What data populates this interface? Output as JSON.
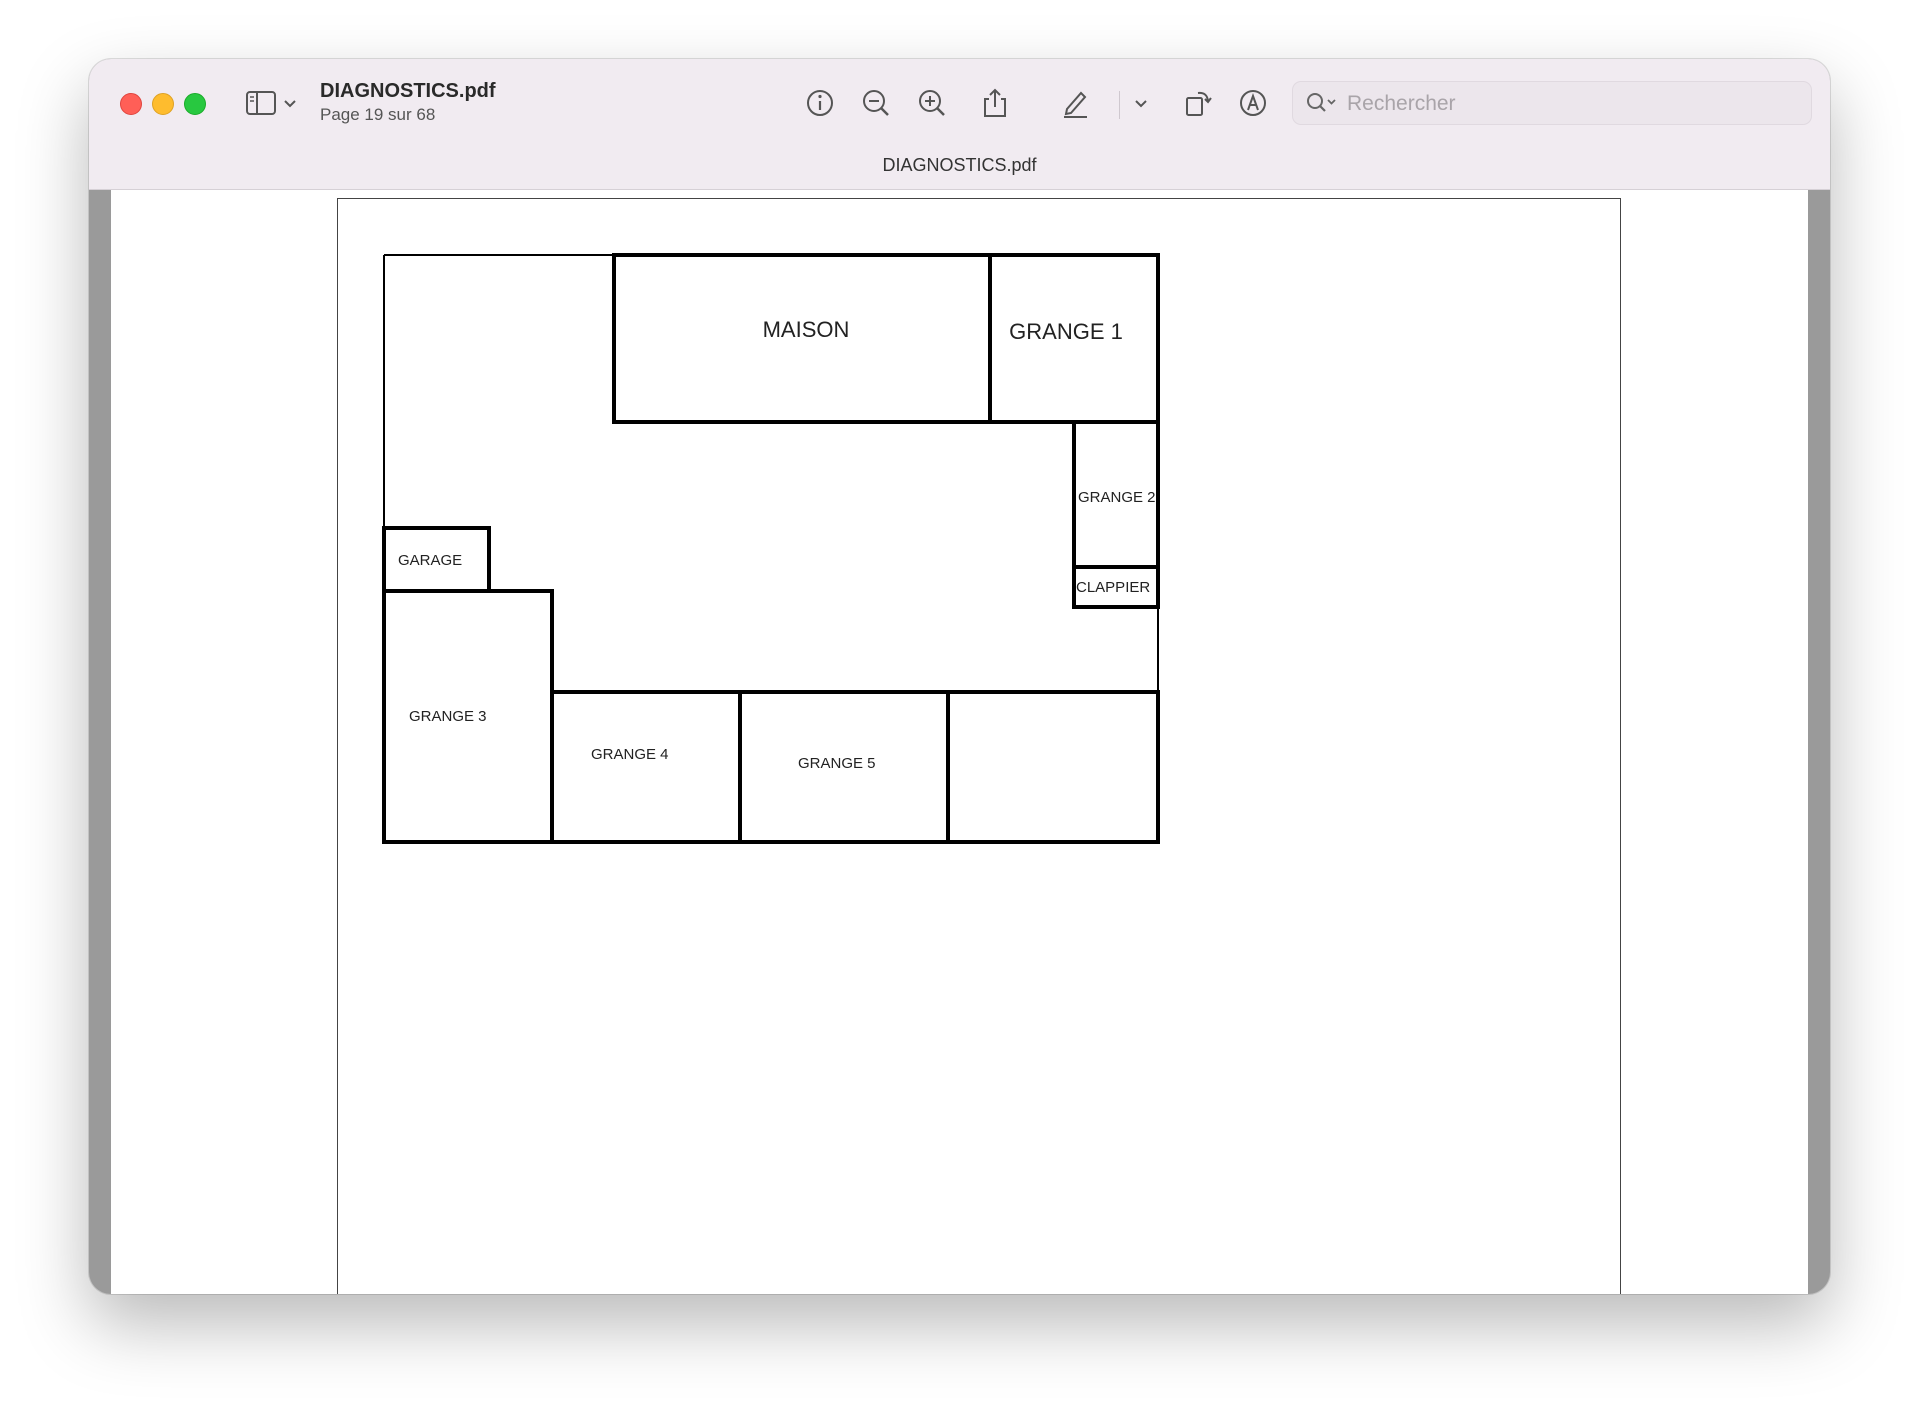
{
  "window": {
    "document_name": "DIAGNOSTICS.pdf",
    "page_info": "Page 19 sur 68",
    "tab_title": "DIAGNOSTICS.pdf"
  },
  "toolbar": {
    "icons": [
      "sidebar-icon",
      "chevron-down-icon",
      "info-icon",
      "zoom-out-icon",
      "zoom-in-icon",
      "share-icon",
      "highlight-pen-icon",
      "chevron-down-icon",
      "rotate-icon",
      "markup-icon",
      "search-icon"
    ],
    "search_placeholder": "Rechercher"
  },
  "floor_plan": {
    "rooms": {
      "maison": "MAISON",
      "grange1": "GRANGE 1",
      "grange2": "GRANGE 2",
      "clappier": "CLAPPIER",
      "garage": "GARAGE",
      "grange3": "GRANGE 3",
      "grange4": "GRANGE 4",
      "grange5": "GRANGE 5"
    }
  },
  "colors": {
    "close": "#ff5f57",
    "minimize": "#febc2e",
    "maximize": "#28c840",
    "titlebar": "#f1ebf1"
  }
}
